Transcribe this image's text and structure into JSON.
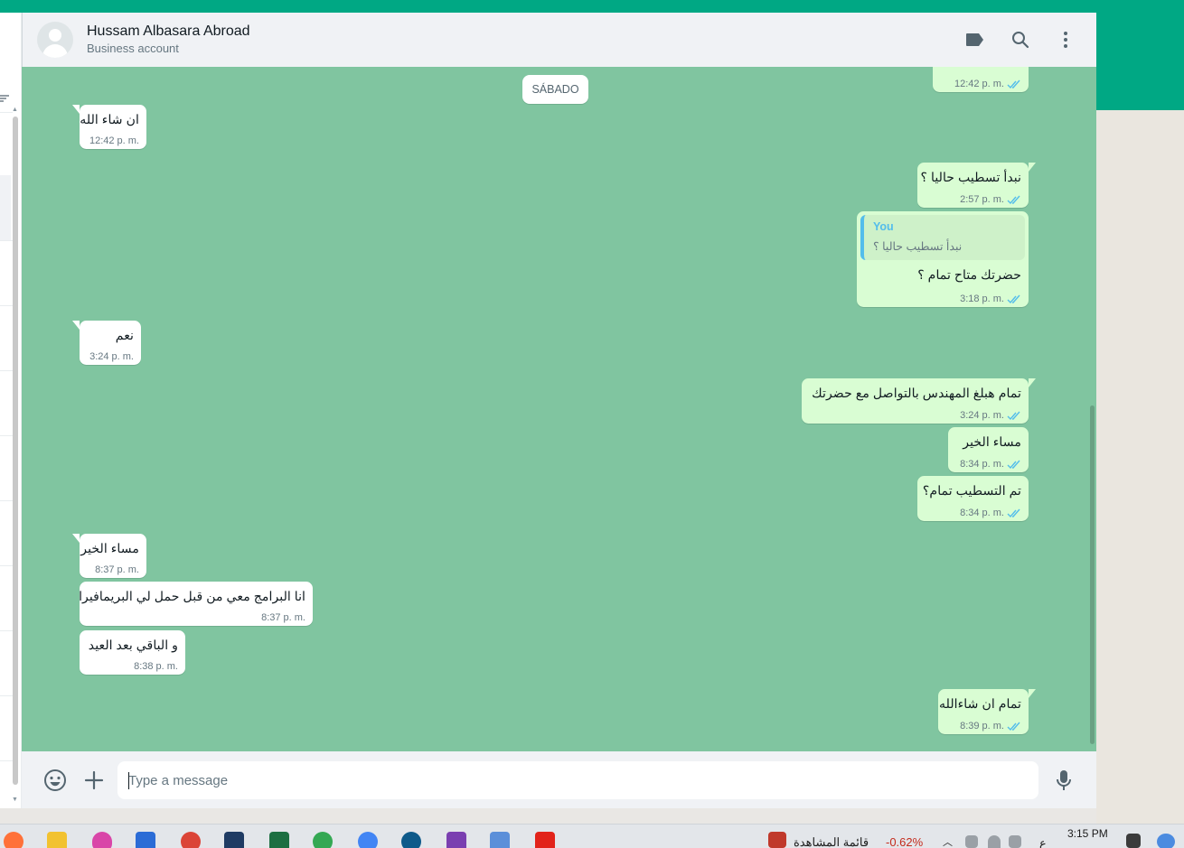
{
  "header": {
    "contact_name": "Hussam Albasara Abroad",
    "subtitle": "Business account",
    "icons": [
      "label-icon",
      "search-icon",
      "menu-icon"
    ]
  },
  "chat": {
    "date_divider": "SÁBADO",
    "partial_top": {
      "time": "12:42 p. m."
    },
    "messages": [
      {
        "dir": "in",
        "text": "ان شاء الله",
        "time": "12:42 p. m."
      },
      {
        "dir": "out",
        "text": "نبدأ تسطيب حاليا ؟",
        "time": "2:57 p. m."
      },
      {
        "dir": "out",
        "quote_author": "You",
        "quote_text": "نبدأ تسطيب حاليا ؟",
        "text": "حضرتك متاح تمام ؟",
        "time": "3:18 p. m."
      },
      {
        "dir": "in",
        "text": "نعم",
        "time": "3:24 p. m."
      },
      {
        "dir": "out",
        "text": "تمام هبلغ المهندس بالتواصل مع حضرتك",
        "time": "3:24 p. m."
      },
      {
        "dir": "out",
        "text": "مساء الخير",
        "time": "8:34 p. m."
      },
      {
        "dir": "out",
        "text": "تم التسطيب تمام؟",
        "time": "8:34 p. m."
      },
      {
        "dir": "in",
        "text": "مساء الخير",
        "time": "8:37 p. m."
      },
      {
        "dir": "in",
        "text": "انا البرامج معي من قبل حمل لي البريمافيرا",
        "time": "8:37 p. m."
      },
      {
        "dir": "in",
        "text": "و الباقي بعد العيد",
        "time": "8:38 p. m."
      },
      {
        "dir": "out",
        "text": "تمام ان شاءالله",
        "time": "8:39 p. m."
      }
    ]
  },
  "composer": {
    "placeholder": "Type a message"
  },
  "taskbar": {
    "widget_text": "قائمة المشاهدة",
    "widget_value": "-0.62%",
    "clock_time": "3:15 PM",
    "lang": "ع"
  },
  "colors": {
    "accent": "#00a884",
    "chat_bg": "#80c5a0",
    "bubble_out": "#d9fdd3",
    "bubble_in": "#ffffff",
    "tick_read": "#53bdeb"
  }
}
